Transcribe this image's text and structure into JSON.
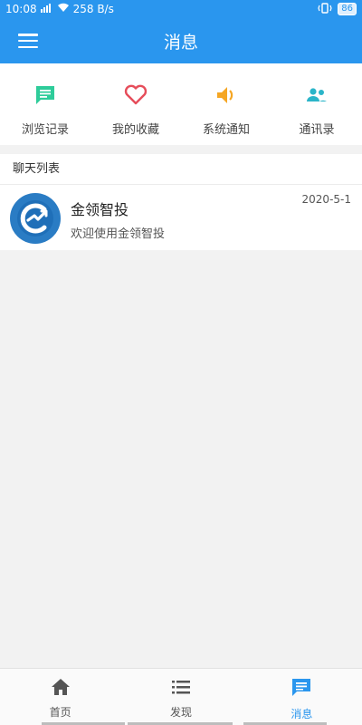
{
  "status": {
    "time": "10:08",
    "speed": "258 B/s",
    "battery": "86"
  },
  "header": {
    "title": "消息",
    "background": "#2a96ee"
  },
  "shortcuts": [
    {
      "label": "浏览记录",
      "icon": "chat-icon",
      "color": "#2ecc9a"
    },
    {
      "label": "我的收藏",
      "icon": "heart-icon",
      "color": "#e64d5a"
    },
    {
      "label": "系统通知",
      "icon": "speaker-icon",
      "color": "#f5a623"
    },
    {
      "label": "通讯录",
      "icon": "contacts-icon",
      "color": "#2bb5c9"
    }
  ],
  "chat_list": {
    "title": "聊天列表",
    "items": [
      {
        "name": "金领智投",
        "message": "欢迎使用金领智投",
        "date": "2020-5-1"
      }
    ]
  },
  "bottom_nav": [
    {
      "label": "首页",
      "icon": "home-icon"
    },
    {
      "label": "发现",
      "icon": "list-icon"
    },
    {
      "label": "消息",
      "icon": "message-icon",
      "active": true
    }
  ]
}
